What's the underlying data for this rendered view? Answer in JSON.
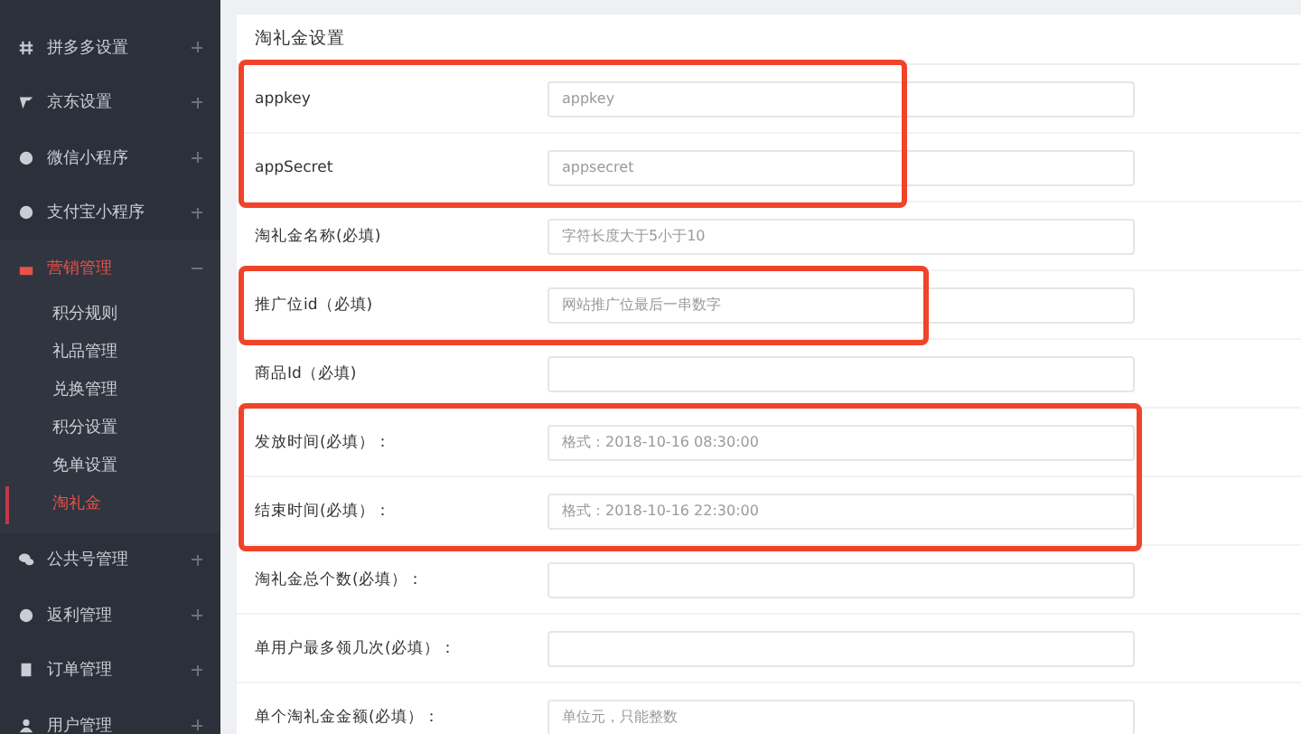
{
  "sidebar": {
    "items": [
      {
        "label": "拼多多设置",
        "expanded": false,
        "selected": false
      },
      {
        "label": "京东设置",
        "expanded": false,
        "selected": false
      },
      {
        "label": "微信小程序",
        "expanded": false,
        "selected": false
      },
      {
        "label": "支付宝小程序",
        "expanded": false,
        "selected": false
      },
      {
        "label": "营销管理",
        "expanded": true,
        "selected": true,
        "children": [
          {
            "label": "积分规则",
            "selected": false
          },
          {
            "label": "礼品管理",
            "selected": false
          },
          {
            "label": "兑换管理",
            "selected": false
          },
          {
            "label": "积分设置",
            "selected": false
          },
          {
            "label": "免单设置",
            "selected": false
          },
          {
            "label": "淘礼金",
            "selected": true
          }
        ]
      },
      {
        "label": "公共号管理",
        "expanded": false,
        "selected": false
      },
      {
        "label": "返利管理",
        "expanded": false,
        "selected": false
      },
      {
        "label": "订单管理",
        "expanded": false,
        "selected": false
      },
      {
        "label": "用户管理",
        "expanded": false,
        "selected": false
      }
    ]
  },
  "form": {
    "title": "淘礼金设置",
    "groups": [
      {
        "highlighted": true,
        "rows": [
          {
            "label": "appkey",
            "placeholder": "appkey"
          },
          {
            "label": "appSecret",
            "placeholder": "appsecret"
          }
        ]
      },
      {
        "highlighted": false,
        "rows": [
          {
            "label": "淘礼金名称(必填)",
            "placeholder": "字符长度大于5小于10"
          }
        ]
      },
      {
        "highlighted": true,
        "rows": [
          {
            "label": "推广位id（必填)",
            "placeholder": "网站推广位最后一串数字"
          }
        ]
      },
      {
        "highlighted": false,
        "rows": [
          {
            "label": "商品Id（必填)"
          }
        ]
      },
      {
        "highlighted": true,
        "rows": [
          {
            "label": "发放时间(必填）：",
            "placeholder": "格式：2018-10-16 08:30:00"
          },
          {
            "label": "结束时间(必填）：",
            "placeholder": "格式：2018-10-16 22:30:00"
          }
        ]
      },
      {
        "highlighted": false,
        "rows": [
          {
            "label": "淘礼金总个数(必填）："
          },
          {
            "label": "单用户最多领几次(必填）："
          },
          {
            "label": "单个淘礼金金额(必填）：",
            "placeholder": "单位元，只能整数"
          }
        ]
      }
    ]
  }
}
